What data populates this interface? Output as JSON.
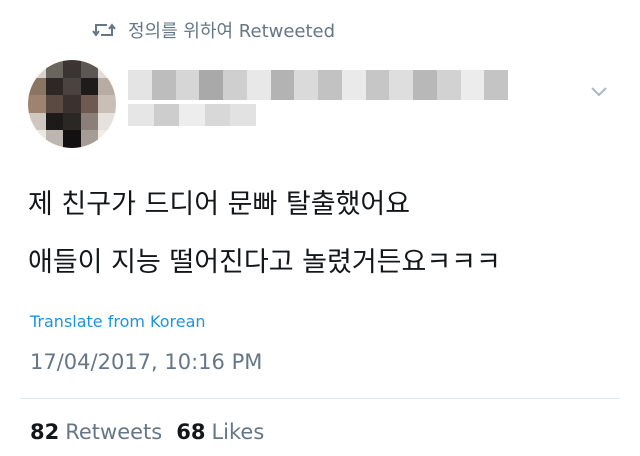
{
  "retweet_header": {
    "text": "정의를 위하여 Retweeted"
  },
  "tweet": {
    "lines": [
      "제 친구가 드디어 문빠 탈출했어요",
      "애들이 지능 떨어진다고 놀렸거든요ㅋㅋㅋ"
    ],
    "translate_link": "Translate from Korean",
    "timestamp": "17/04/2017, 10:16 PM"
  },
  "stats": {
    "retweets_count": "82",
    "retweets_label": "Retweets",
    "likes_count": "68",
    "likes_label": "Likes"
  },
  "colors": {
    "link": "#1b95e0",
    "muted": "#657786",
    "text": "#14171a"
  }
}
